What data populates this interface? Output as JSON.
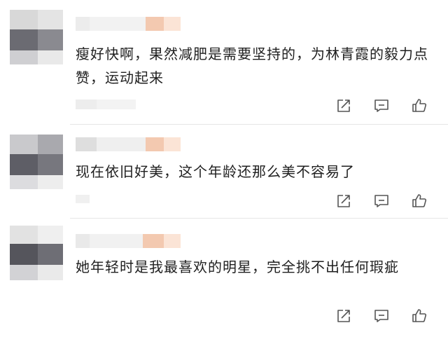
{
  "comments": [
    {
      "text": "瘦好快啊，果然减肥是需要坚持的，为林青霞的毅力点赞，运动起来",
      "actions": [
        "share-icon",
        "reply-icon",
        "like-icon"
      ]
    },
    {
      "text": "现在依旧好美，这个年龄还那么美不容易了",
      "actions": [
        "share-icon",
        "reply-icon",
        "like-icon"
      ]
    },
    {
      "text": "她年轻时是我最喜欢的明星，完全挑不出任何瑕疵",
      "actions": [
        "share-icon",
        "reply-icon",
        "like-icon"
      ]
    }
  ],
  "colors": {
    "icon": "#555555",
    "accent_mosaic": "#f3c9b0",
    "divider": "#e6e6e6"
  }
}
